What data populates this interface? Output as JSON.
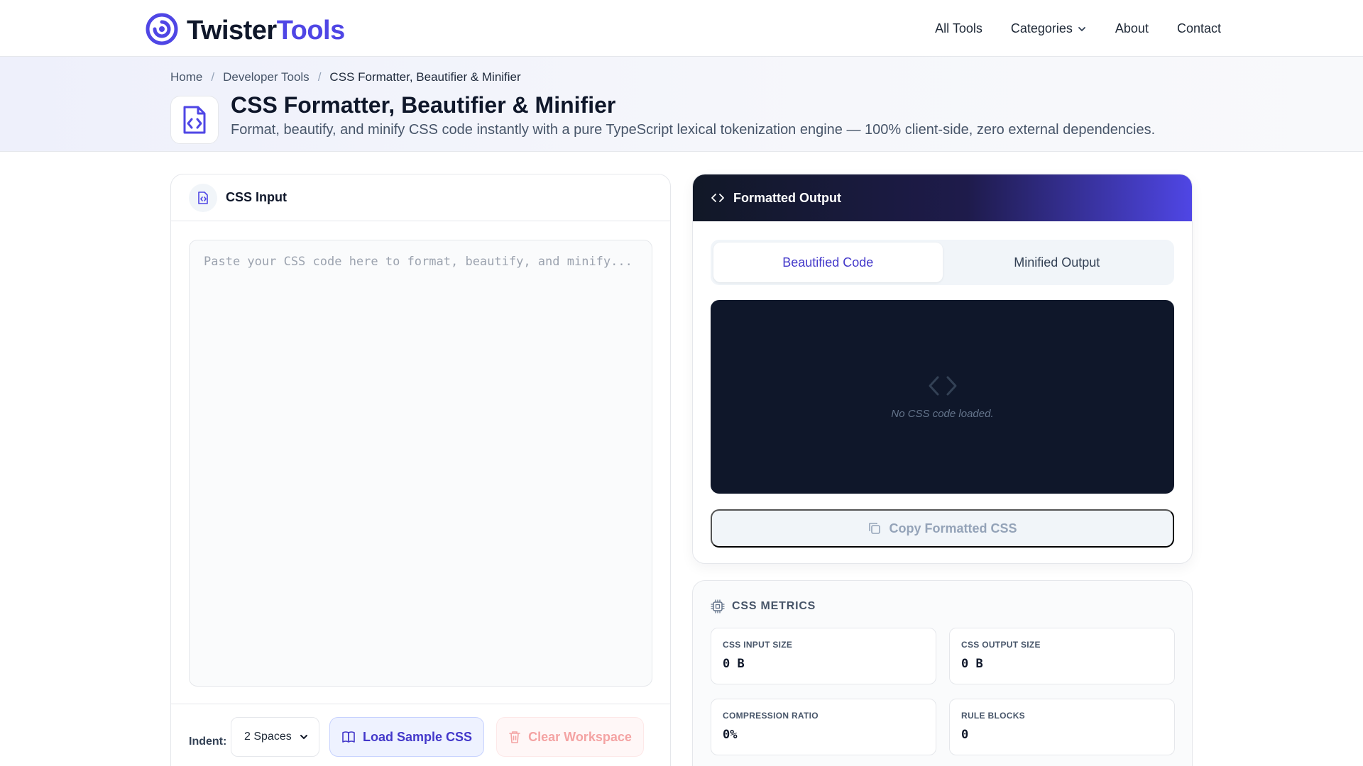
{
  "brand": {
    "name_part1": "Twister",
    "name_part2": "Tools",
    "primary": "#4f46e5"
  },
  "nav": {
    "items": [
      "All Tools",
      "Categories",
      "About",
      "Contact"
    ]
  },
  "breadcrumb": {
    "home": "Home",
    "section": "Developer Tools",
    "current": "CSS Formatter, Beautifier & Minifier"
  },
  "hero": {
    "title": "CSS Formatter, Beautifier & Minifier",
    "subtitle": "Format, beautify, and minify CSS code instantly with a pure TypeScript lexical tokenization engine — 100% client-side, zero external dependencies."
  },
  "input_panel": {
    "title": "CSS Input",
    "placeholder": "Paste your CSS code here to format, beautify, and minify...",
    "value": "",
    "indent_label": "Indent:",
    "indent_value": "2 Spaces",
    "load_sample_label": "Load Sample CSS",
    "clear_label": "Clear Workspace"
  },
  "output_panel": {
    "title": "Formatted Output",
    "tabs": [
      "Beautified Code",
      "Minified Output"
    ],
    "active_tab": "Beautified Code",
    "empty_text": "No CSS code loaded.",
    "copy_label": "Copy Formatted CSS"
  },
  "metrics": {
    "title": "CSS METRICS",
    "items": [
      {
        "label": "CSS INPUT SIZE",
        "value": "0 B"
      },
      {
        "label": "CSS OUTPUT SIZE",
        "value": "0 B"
      },
      {
        "label": "COMPRESSION RATIO",
        "value": "0%"
      },
      {
        "label": "RULE BLOCKS",
        "value": "0"
      }
    ]
  },
  "icons": {
    "logo": "swirl-logo-icon",
    "hero": "code-file-icon",
    "input": "file-code-icon",
    "output": "code-brackets-icon",
    "chevron": "chevron-down-icon",
    "book": "book-open-icon",
    "trash": "trash-icon",
    "copy": "copy-icon",
    "cpu": "cpu-chip-icon"
  }
}
